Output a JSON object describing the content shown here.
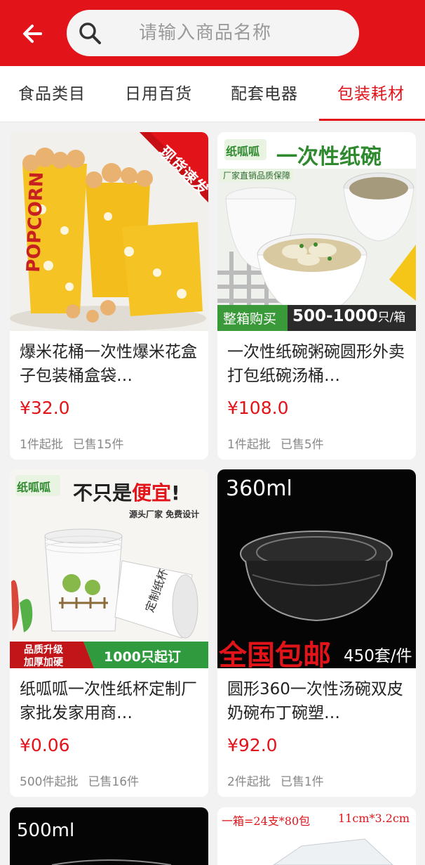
{
  "header": {
    "back_icon": "arrow-left-icon",
    "search_icon": "search-icon",
    "search_placeholder": "请输入商品名称",
    "brand_color": "#e2141a"
  },
  "tabs": [
    {
      "label": "食品类目",
      "active": false
    },
    {
      "label": "日用百货",
      "active": false
    },
    {
      "label": "配套电器",
      "active": false
    },
    {
      "label": "包装耗材",
      "active": true
    }
  ],
  "products": [
    {
      "title": "爆米花桶一次性爆米花盒子包装桶盒袋…",
      "price": "¥32.0",
      "min_order": "1件起批",
      "sold": "已售15件",
      "image_text": {
        "corner_banner": "现货速发",
        "cup_text": "POPCORN"
      }
    },
    {
      "title": "一次性纸碗粥碗圆形外卖打包纸碗汤桶…",
      "price": "¥108.0",
      "min_order": "1件起批",
      "sold": "已售5件",
      "image_text": {
        "logo": "纸呱呱",
        "headline": "一次性纸碗",
        "sub_badge": "厂家直销品质保障",
        "bottom_left": "整箱购买",
        "bottom_qty": "500-1000",
        "bottom_unit": "只/箱"
      }
    },
    {
      "title": "纸呱呱一次性纸杯定制厂家批发家用商…",
      "price": "¥0.06",
      "min_order": "500件起批",
      "sold": "已售16件",
      "image_text": {
        "logo": "纸呱呱",
        "headline_a": "不只是",
        "headline_b": "便宜",
        "headline_c": "!",
        "sub": "源头厂家  免费设计",
        "cup_text": "定制纸杯",
        "badge_line1": "品质升级",
        "badge_line2": "加厚加硬",
        "badge_right": "1000只起订"
      }
    },
    {
      "title": "圆形360一次性汤碗双皮奶碗布丁碗塑…",
      "price": "¥92.0",
      "min_order": "2件起批",
      "sold": "已售1件",
      "image_text": {
        "volume": "360ml",
        "promo": "全国包邮",
        "pack": "450套/件"
      }
    },
    {
      "image_text": {
        "volume": "500ml"
      }
    },
    {
      "image_text": {
        "spec_left": "一箱=24支*80包",
        "spec_right": "11cm*3.2cm"
      }
    }
  ]
}
